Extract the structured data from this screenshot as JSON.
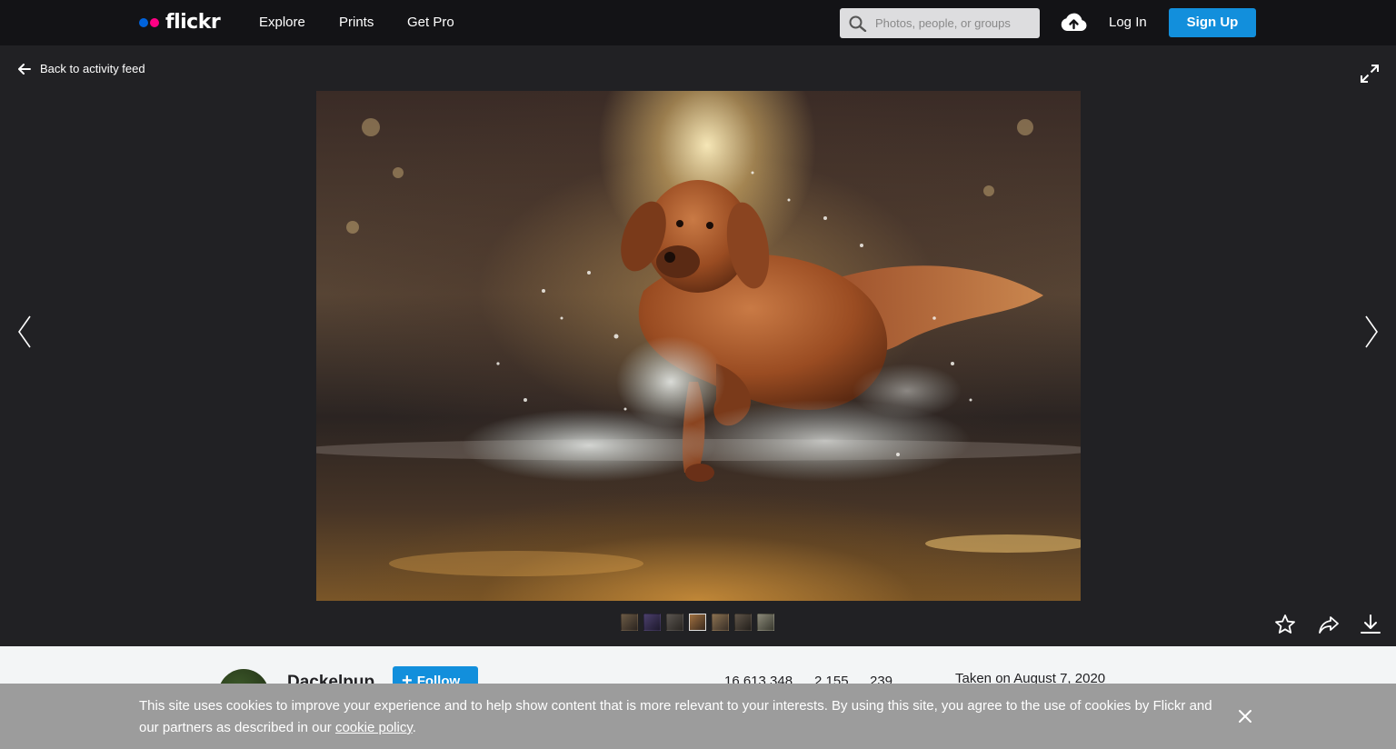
{
  "brand": {
    "logo_text": "flickr",
    "blue": "#0063dc",
    "pink": "#ff0084"
  },
  "nav": {
    "links": [
      "Explore",
      "Prints",
      "Get Pro"
    ],
    "search_placeholder": "Photos, people, or groups",
    "upload_icon": "cloud-upload-icon",
    "login_label": "Log In",
    "signup_label": "Sign Up"
  },
  "viewer": {
    "back_label": "Back to activity feed",
    "photo_description": "dog running through water",
    "thumbnail_count": 7,
    "active_thumbnail": 4,
    "actions": [
      "star-icon",
      "share-icon",
      "download-icon"
    ]
  },
  "owner": {
    "name": "Dackelpup",
    "follow_label": "Follow",
    "stats": [
      "16,613,348",
      "2,155",
      "239"
    ],
    "taken": "Taken on August 7, 2020"
  },
  "cookie": {
    "text_before": "This site uses cookies to improve your experience and to help show content that is more relevant to your interests. By using this site, you agree to the use of cookies by Flickr and our partners as described in our ",
    "link": "cookie policy",
    "text_after": "."
  },
  "colors": {
    "accent": "#128fdc",
    "topbar": "#131316",
    "stage": "#212124",
    "banner": "#9c9c9c"
  }
}
